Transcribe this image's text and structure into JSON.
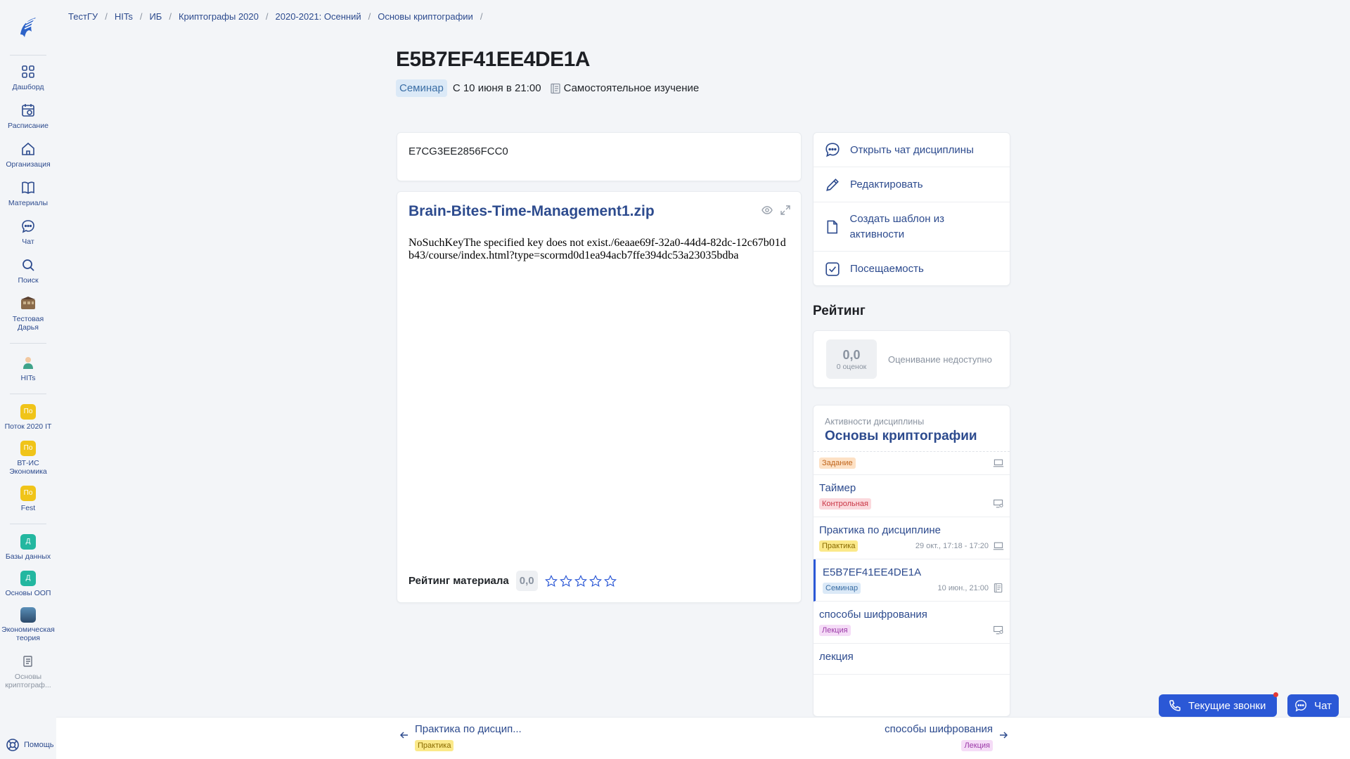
{
  "sidebar": {
    "items": [
      {
        "label": "Дашборд"
      },
      {
        "label": "Расписание"
      },
      {
        "label": "Организация"
      },
      {
        "label": "Материалы"
      },
      {
        "label": "Чат"
      },
      {
        "label": "Поиск"
      },
      {
        "label": "Тестовая Дарья"
      },
      {
        "label": "HITs"
      }
    ],
    "groups": [
      {
        "avatar": "По",
        "label": "Поток 2020 IT",
        "color": "#f0c419"
      },
      {
        "avatar": "По",
        "label": "ВТ-ИС Экономика",
        "color": "#f0c419"
      },
      {
        "avatar": "По",
        "label": "Fest",
        "color": "#f0c419"
      }
    ],
    "courses": [
      {
        "avatar": "Д",
        "label": "Базы данных",
        "color": "#23b7a0"
      },
      {
        "avatar": "Д",
        "label": "Основы ООП",
        "color": "#23b7a0"
      },
      {
        "avatar": "",
        "label": "Экономическая теория",
        "color": "#3f6d8f"
      },
      {
        "avatar": "",
        "label": "Основы криптограф...",
        "color": "#cfd4da"
      }
    ],
    "help_label": "Помощь"
  },
  "breadcrumb": [
    "ТестГУ",
    "HITs",
    "ИБ",
    "Криптографы 2020",
    "2020-2021: Осенний",
    "Основы криптографии"
  ],
  "page": {
    "title": "E5B7EF41EE4DE1A",
    "type_badge": "Семинар",
    "date": "С 10 июня в 21:00",
    "mode": "Самостоятельное изучение"
  },
  "description": "E7CG3EE2856FCC0",
  "file": {
    "name": "Brain-Bites-Time-Management1.zip",
    "error_text": "NoSuchKeyThe specified key does not exist./6eaae69f-32a0-44d4-82dc-12c67b01db43/course/index.html?type=scormd0d1ea94acb7ffe394dc53a23035bdba",
    "rating_label": "Рейтинг материала",
    "rating_value": "0,0",
    "stars": 0
  },
  "actions": [
    {
      "label": "Открыть чат дисциплины",
      "icon": "chat-icon"
    },
    {
      "label": "Редактировать",
      "icon": "pencil-icon"
    },
    {
      "label": "Создать шаблон из активности",
      "icon": "document-icon"
    },
    {
      "label": "Посещаемость",
      "icon": "checkbox-icon"
    }
  ],
  "rating": {
    "heading": "Рейтинг",
    "score": "0,0",
    "count": "0 оценок",
    "status": "Оценивание недоступно"
  },
  "activities": {
    "subtitle": "Активности дисциплины",
    "discipline": "Основы криптографии",
    "items": [
      {
        "name": "",
        "tag": "Задание",
        "tag_class": "tag-task",
        "time": "",
        "icon": "laptop-icon"
      },
      {
        "name": "Таймер",
        "tag": "Контрольная",
        "tag_class": "tag-ctrl",
        "time": "",
        "icon": "screen-user-icon"
      },
      {
        "name": "Практика по дисциплине",
        "tag": "Практика",
        "tag_class": "tag-prac",
        "time": "29 окт., 17:18 - 17:20",
        "icon": "laptop-icon"
      },
      {
        "name": "E5B7EF41EE4DE1A",
        "tag": "Семинар",
        "tag_class": "tag-sem",
        "time": "10 июн., 21:00",
        "icon": "book-icon",
        "active": true
      },
      {
        "name": "способы шифрования",
        "tag": "Лекция",
        "tag_class": "tag-lec",
        "time": "",
        "icon": "screen-user-icon"
      },
      {
        "name": "лекция",
        "tag": "",
        "tag_class": "",
        "time": "",
        "icon": ""
      }
    ]
  },
  "nav": {
    "prev": {
      "label": "Практика по дисцип...",
      "tag": "Практика"
    },
    "next": {
      "label": "способы шифрования",
      "tag": "Лекция"
    }
  },
  "floating": {
    "calls_label": "Текущие звонки",
    "chat_label": "Чат"
  }
}
